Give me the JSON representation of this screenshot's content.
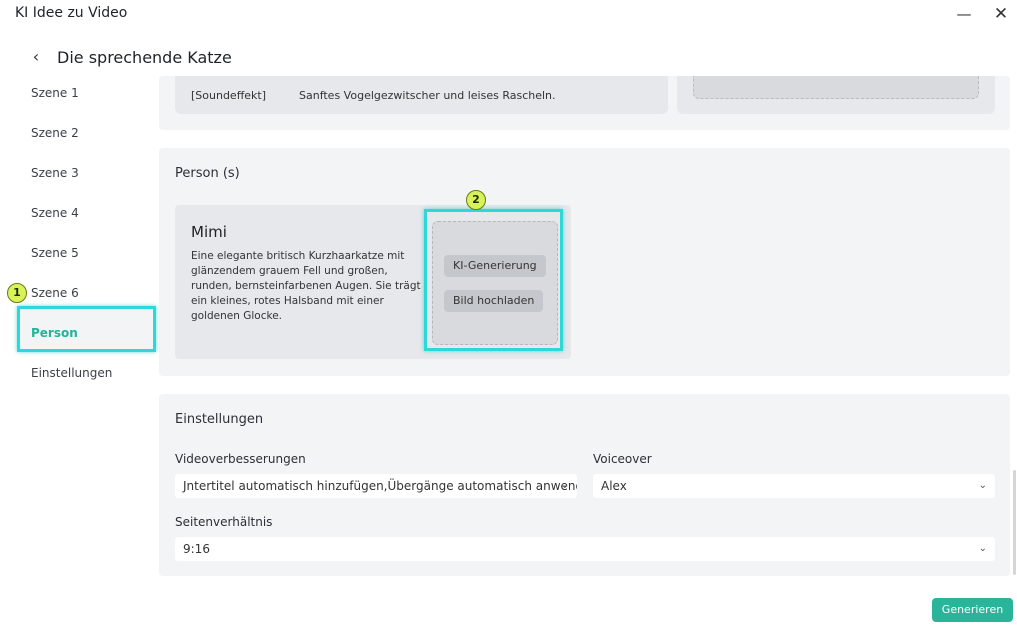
{
  "window": {
    "title": "KI Idee zu Video",
    "minimize_glyph": "—",
    "close_glyph": "✕"
  },
  "header": {
    "back_glyph": "‹",
    "title": "Die sprechende Katze"
  },
  "sidebar": {
    "items": [
      {
        "label": "Szene 1"
      },
      {
        "label": "Szene 2"
      },
      {
        "label": "Szene 3"
      },
      {
        "label": "Szene 4"
      },
      {
        "label": "Szene 5"
      },
      {
        "label": "Szene 6"
      },
      {
        "label": "Person"
      },
      {
        "label": "Einstellungen"
      }
    ],
    "active": "Person"
  },
  "scene": {
    "sound_tag": "[Soundeffekt]",
    "sound_text": "Sanftes Vogelgezwitscher und leises Rascheln."
  },
  "person_section": {
    "title": "Person (s)",
    "person": {
      "name": "Mimi",
      "description": "Eine elegante britisch Kurzhaarkatze mit glänzendem grauem Fell und großen, runden, bernsteinfarbenen Augen. Sie trägt ein kleines, rotes Halsband mit einer goldenen Glocke.",
      "ai_button": "KI-Generierung",
      "upload_button": "Bild hochladen"
    }
  },
  "settings": {
    "title": "Einstellungen",
    "video_label": "Videoverbesserungen",
    "video_value": "Jntertitel automatisch hinzufügen,Übergänge automatisch anwenden",
    "voice_label": "Voiceover",
    "voice_value": "Alex",
    "aspect_label": "Seitenverhältnis",
    "aspect_value": "9:16"
  },
  "footer": {
    "generate_label": "Generieren"
  },
  "annotations": {
    "badge1": "1",
    "badge2": "2"
  },
  "colors": {
    "accent": "#2ab59b",
    "highlight": "#2fd8d8"
  },
  "icons": {
    "chevron": "⌄"
  }
}
